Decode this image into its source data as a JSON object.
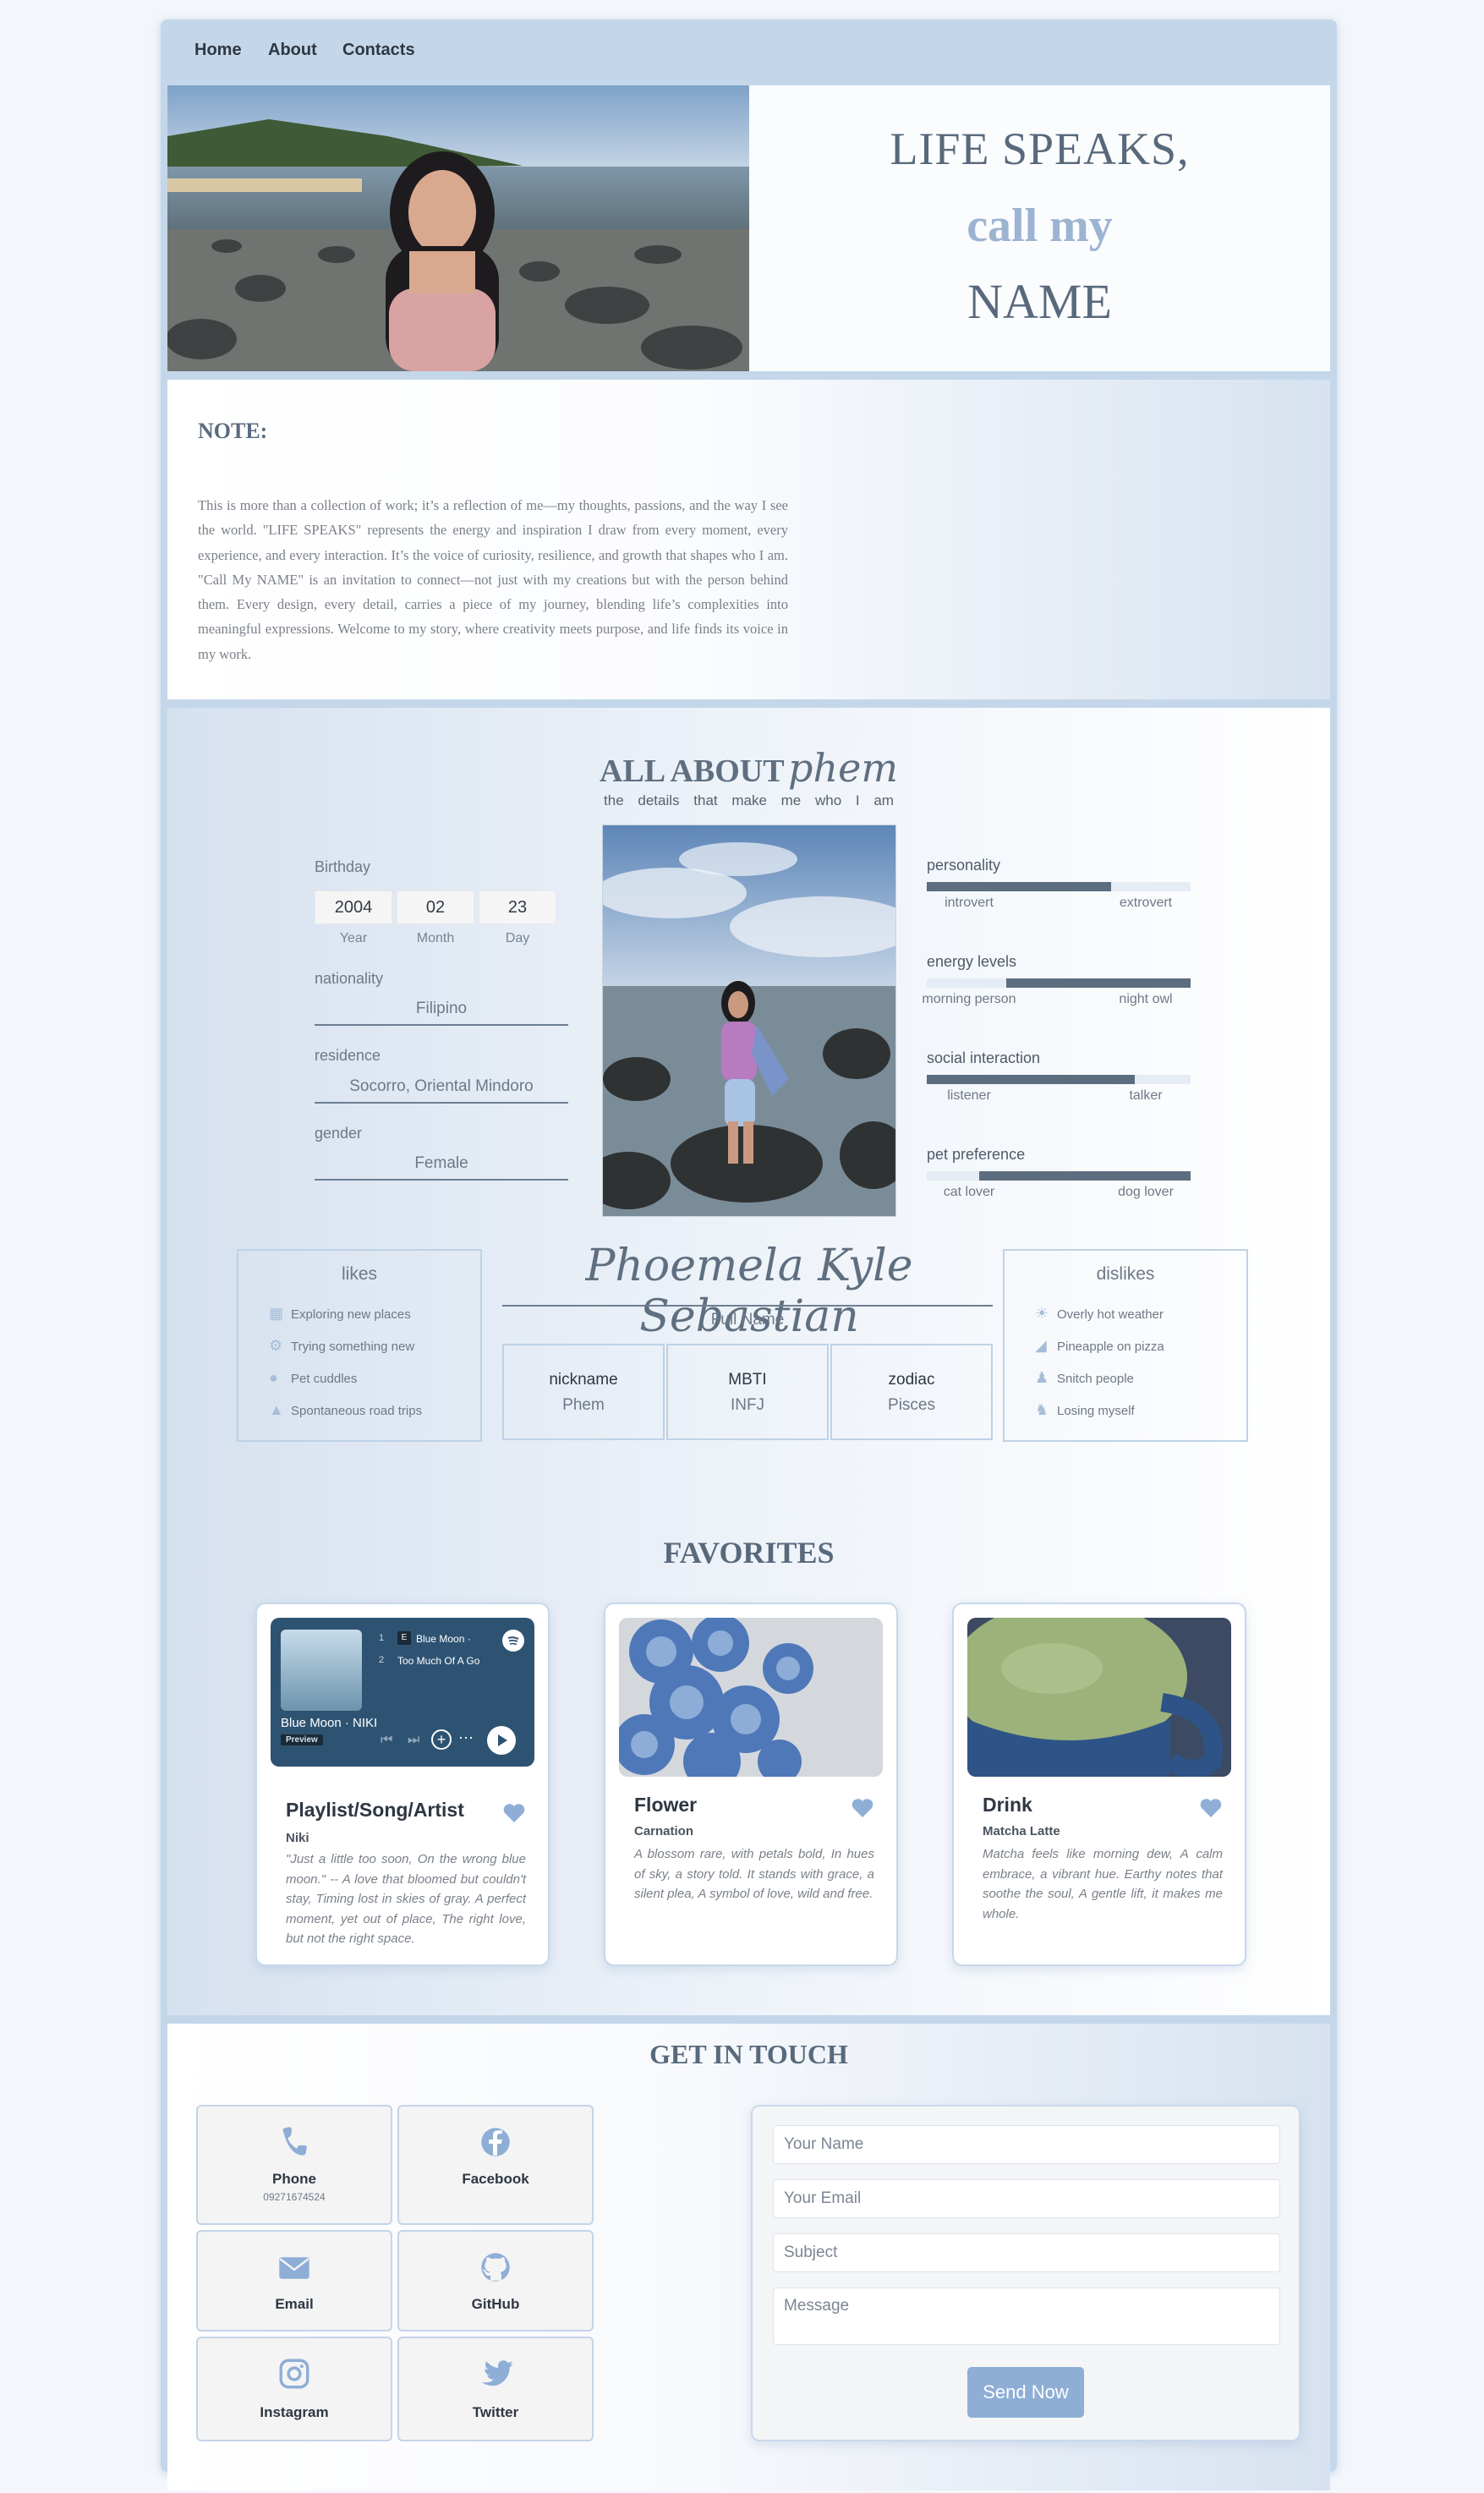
{
  "nav": {
    "home": "Home",
    "about": "About",
    "contacts": "Contacts"
  },
  "hero": {
    "line1": "LIFE SPEAKS,",
    "line2": "call my",
    "line3": "NAME"
  },
  "note": {
    "title": "NOTE:",
    "body": "This is more than a collection of work; it’s a reflection of me—my thoughts, passions, and the way I see the world. \"LIFE SPEAKS\" represents the energy and inspiration I draw from every moment, every experience, and every interaction. It’s the voice of curiosity, resilience, and growth that shapes who I am. \"Call My NAME\" is an invitation to connect—not just with my creations but with the person behind them. Every design, every detail, carries a piece of my journey, blending life’s complexities into meaningful expressions. Welcome to my story, where creativity meets purpose, and life finds its voice in my work."
  },
  "about": {
    "title_a": "ALL ABOUT",
    "title_b": "phem",
    "subtitle": "the details that make me who I am",
    "birthday": {
      "label": "Birthday",
      "year": "2004",
      "month": "02",
      "day": "23",
      "year_label": "Year",
      "month_label": "Month",
      "day_label": "Day"
    },
    "nationality": {
      "label": "nationality",
      "value": "Filipino"
    },
    "residence": {
      "label": "residence",
      "value": "Socorro, Oriental Mindoro"
    },
    "gender": {
      "label": "gender",
      "value": "Female"
    },
    "traits": [
      {
        "title": "personality",
        "left": "introvert",
        "right": "extrovert",
        "fill_start": 0.0,
        "fill_end": 0.7
      },
      {
        "title": "energy levels",
        "left": "morning person",
        "right": "night owl",
        "fill_start": 0.3,
        "fill_end": 1.0
      },
      {
        "title": "social interaction",
        "left": "listener",
        "right": "talker",
        "fill_start": 0.0,
        "fill_end": 0.79
      },
      {
        "title": "pet preference",
        "left": "cat lover",
        "right": "dog lover",
        "fill_start": 0.2,
        "fill_end": 1.0
      }
    ],
    "likes": {
      "title": "likes",
      "items": [
        "Exploring new places",
        "Trying something new",
        "Pet cuddles",
        "Spontaneous road trips"
      ]
    },
    "dislikes": {
      "title": "dislikes",
      "items": [
        "Overly hot weather",
        "Pineapple on pizza",
        "Snitch people",
        "Losing myself"
      ]
    },
    "full_name": "Phoemela Kyle Sebastian",
    "full_name_label": "Full Name",
    "nickname": {
      "label": "nickname",
      "value": "Phem"
    },
    "mbti": {
      "label": "MBTI",
      "value": "INFJ"
    },
    "zodiac": {
      "label": "zodiac",
      "value": "Pisces"
    }
  },
  "favorites": {
    "title": "FAVORITES",
    "cards": [
      {
        "title": "Playlist/Song/Artist",
        "sub": "Niki",
        "text": "\"Just a little too soon, On the wrong blue moon.\" -- A love that bloomed but couldn't stay, Timing lost in skies of gray. A perfect moment, yet out of place, The right love, but not the right space."
      },
      {
        "title": "Flower",
        "sub": "Carnation",
        "text": "A blossom rare, with petals bold, In hues of sky, a story told. It stands with grace, a silent plea, A symbol of love, wild and free."
      },
      {
        "title": "Drink",
        "sub": "Matcha Latte",
        "text": "Matcha feels like morning dew, A calm embrace, a vibrant hue. Earthy notes that soothe the soul, A gentle lift, it makes me whole."
      }
    ],
    "spotify": {
      "track1_num": "1",
      "track1": "Blue Moon ·",
      "track2_num": "2",
      "track2": "Too Much Of A Go",
      "now_playing": "Blue Moon · NIKI",
      "preview": "Preview",
      "explicit": "E"
    }
  },
  "contact": {
    "title": "GET IN TOUCH",
    "phone_label": "Phone",
    "phone_number": "09271674524",
    "facebook_label": "Facebook",
    "email_label": "Email",
    "github_label": "GitHub",
    "instagram_label": "Instagram",
    "twitter_label": "Twitter",
    "form": {
      "name_placeholder": "Your Name",
      "email_placeholder": "Your Email",
      "subject_placeholder": "Subject",
      "message_placeholder": "Message",
      "send_label": "Send Now"
    }
  },
  "colors": {
    "accent": "#8eaed6",
    "frame": "#c4d7ea",
    "dark_slate": "#5c6d80"
  }
}
